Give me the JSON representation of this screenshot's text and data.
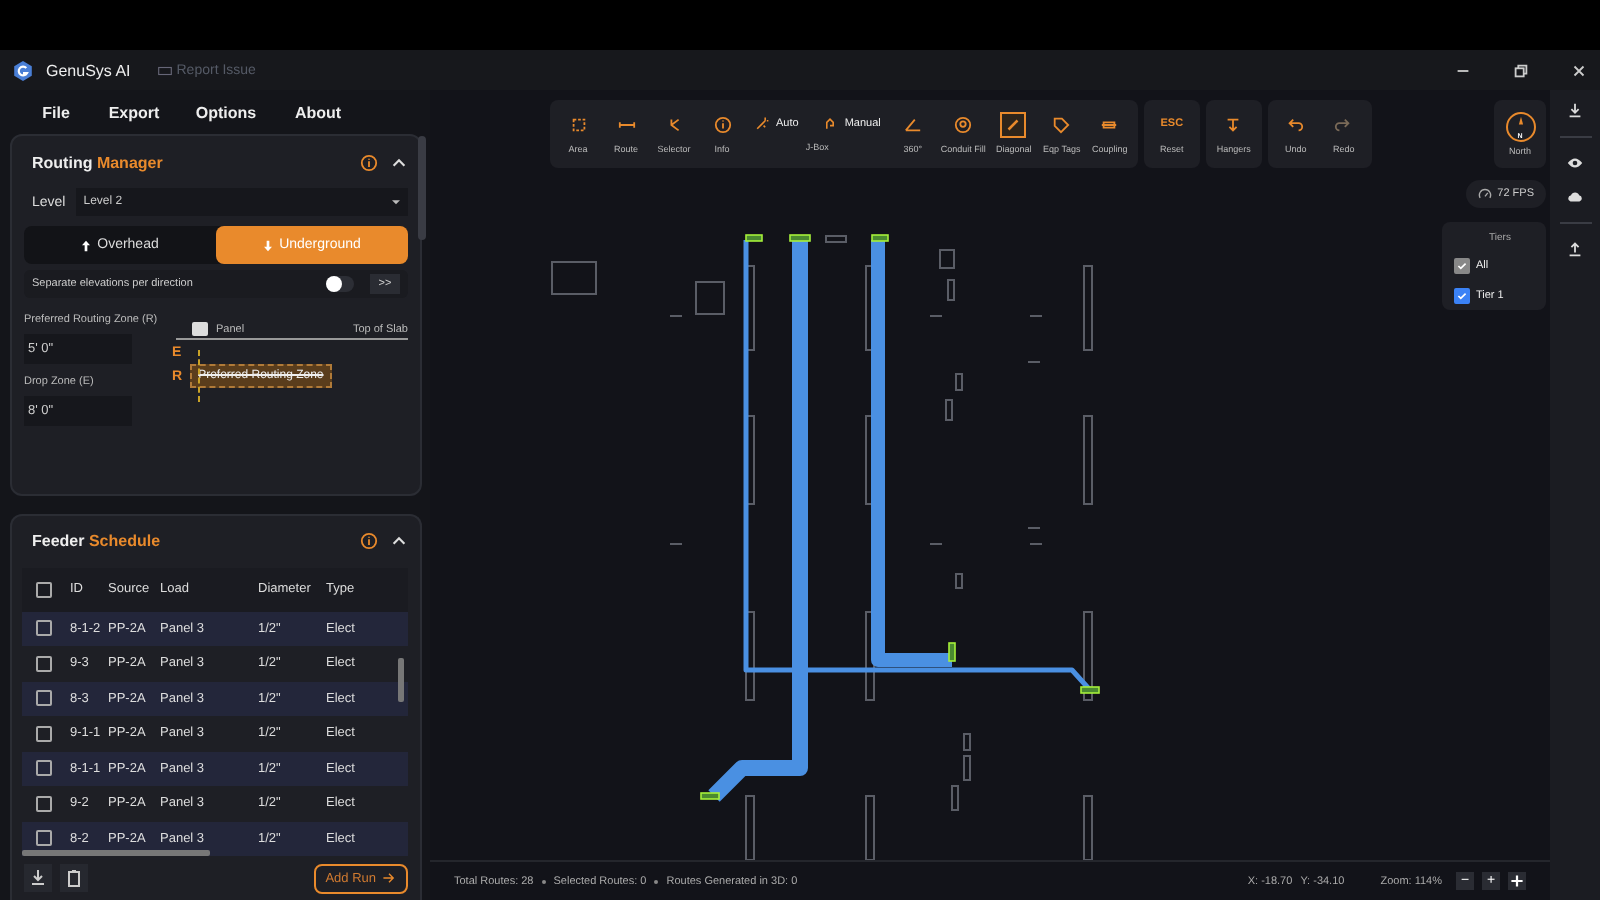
{
  "window": {
    "title": "GenuSys AI",
    "report_link": "Report Issue"
  },
  "menu": [
    "File",
    "Export",
    "Options",
    "About"
  ],
  "routing_manager": {
    "title": "Routing",
    "title_accent": "Manager",
    "expanded": true,
    "level_label": "Level",
    "level_value": "Level 2",
    "directions": [
      {
        "label": "Overhead",
        "selected": false
      },
      {
        "label": "Underground",
        "selected": true
      }
    ],
    "separate_toggle": {
      "label": "Separate elevations per direction",
      "on": false,
      "button": ">>"
    },
    "fields": [
      {
        "label": "Preferred Routing Zone (R)",
        "value": "5' 0\""
      },
      {
        "label": "Drop Zone (E)",
        "value": "8' 0\""
      }
    ],
    "diagram": {
      "panel": "Panel",
      "slab": "Top of Slab",
      "e_mark": "E",
      "r_mark": "R",
      "zone": "Preferred Routing Zone"
    }
  },
  "feeder_schedule": {
    "title": "Feeder",
    "title_accent": "Schedule",
    "expanded": true,
    "select_all": {
      "checked": false
    },
    "columns": [
      "ID",
      "Source",
      "Load",
      "Diameter",
      "Type"
    ],
    "rows": [
      {
        "checked": false,
        "cells": [
          "8-1-2",
          "PP-2A",
          "Panel 3",
          "1/2\"",
          "Elect"
        ]
      },
      {
        "checked": false,
        "cells": [
          "9-3",
          "PP-2A",
          "Panel 3",
          "1/2\"",
          "Elect"
        ]
      },
      {
        "checked": false,
        "cells": [
          "8-3",
          "PP-2A",
          "Panel 3",
          "1/2\"",
          "Elect"
        ]
      },
      {
        "checked": false,
        "cells": [
          "9-1-1",
          "PP-2A",
          "Panel 3",
          "1/2\"",
          "Elect"
        ]
      },
      {
        "checked": false,
        "cells": [
          "8-1-1",
          "PP-2A",
          "Panel 3",
          "1/2\"",
          "Elect"
        ]
      },
      {
        "checked": false,
        "cells": [
          "9-2",
          "PP-2A",
          "Panel 3",
          "1/2\"",
          "Elect"
        ]
      },
      {
        "checked": false,
        "cells": [
          "8-2",
          "PP-2A",
          "Panel 3",
          "1/2\"",
          "Elect"
        ]
      }
    ],
    "add_button": "Add Run"
  },
  "toolbar": [
    {
      "tools": [
        {
          "kind": "tool",
          "label": "Area",
          "selected": false
        },
        {
          "kind": "tool",
          "label": "Route",
          "selected": false
        },
        {
          "kind": "tool",
          "label": "Selector",
          "selected": false
        },
        {
          "kind": "tool",
          "label": "Info",
          "selected": false
        },
        {
          "kind": "jbox",
          "label": "J-Box",
          "options": [
            "Auto",
            "Manual"
          ]
        },
        {
          "kind": "tool",
          "label": "360°",
          "selected": false
        },
        {
          "kind": "tool",
          "label": "Conduit Fill",
          "selected": false
        },
        {
          "kind": "tool",
          "label": "Diagonal",
          "selected": true
        },
        {
          "kind": "tool",
          "label": "Eqp Tags",
          "selected": false
        },
        {
          "kind": "tool",
          "label": "Coupling",
          "selected": false
        }
      ]
    },
    {
      "tools": [
        {
          "kind": "key",
          "label": "Reset",
          "key": "ESC",
          "selected": false
        }
      ]
    },
    {
      "tools": [
        {
          "kind": "tool",
          "label": "Hangers",
          "selected": false
        }
      ]
    },
    {
      "tools": [
        {
          "kind": "tool",
          "label": "Undo",
          "selected": false
        },
        {
          "kind": "tool",
          "label": "Redo",
          "selected": false
        }
      ]
    }
  ],
  "compass": {
    "mark": "N",
    "label": "North"
  },
  "fps": "72 FPS",
  "tiers": {
    "title": "Tiers",
    "items": [
      {
        "label": "All",
        "checked": true,
        "kind": "all"
      },
      {
        "label": "Tier 1",
        "checked": true,
        "kind": "tier"
      }
    ]
  },
  "status_bar": {
    "stats": [
      "Total Routes: 28",
      "Selected Routes: 0",
      "Routes Generated in 3D: 0"
    ],
    "x": "X: -18.70",
    "y": "Y: -34.10",
    "zoom": "Zoom: 114%",
    "zoom_buttons": [
      "−",
      "+"
    ]
  }
}
